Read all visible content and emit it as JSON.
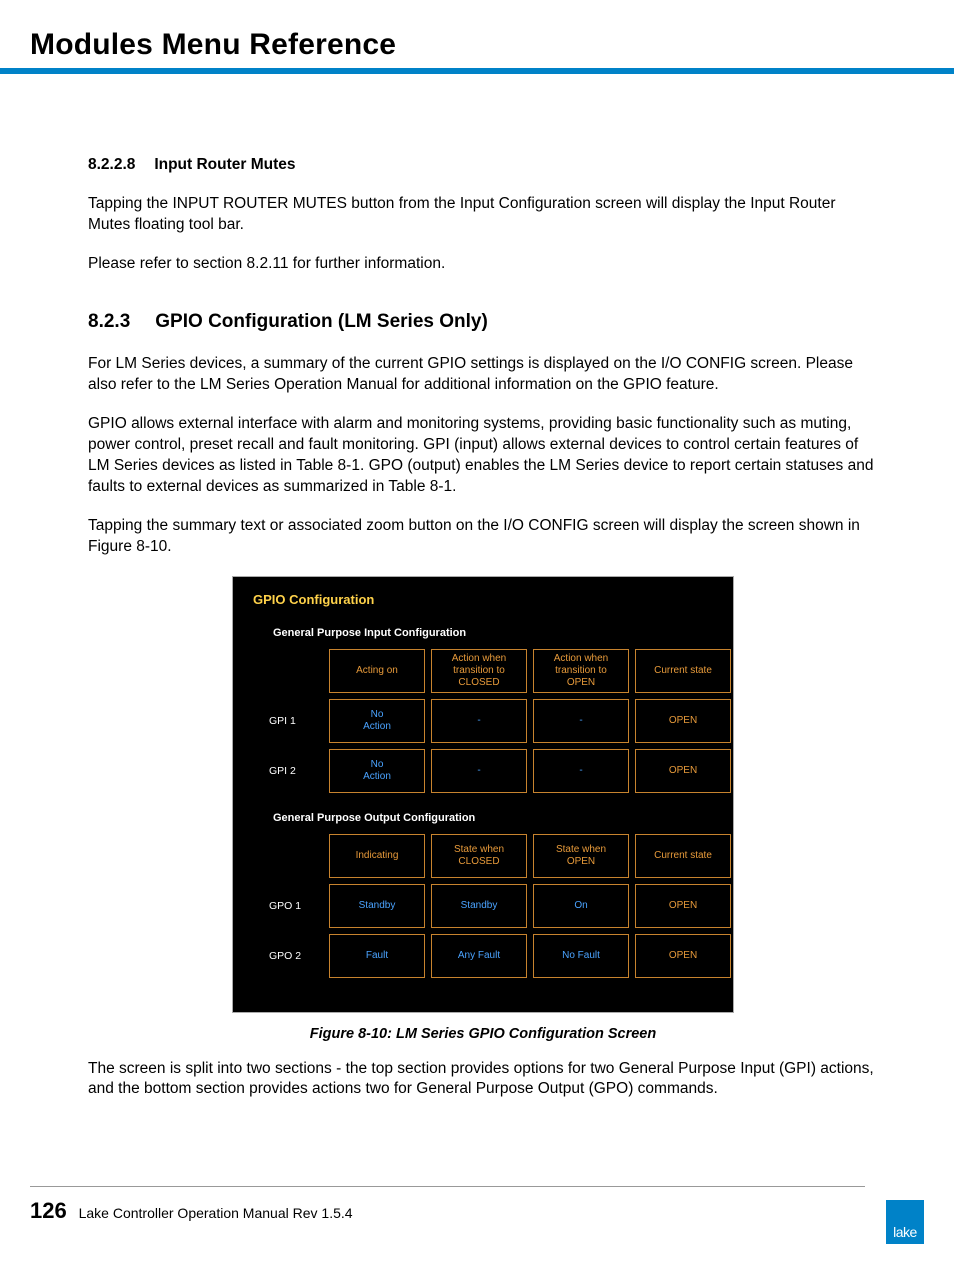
{
  "header": {
    "title": "Modules Menu Reference"
  },
  "section_8228": {
    "num": "8.2.2.8",
    "title": "Input Router Mutes",
    "p1": "Tapping the INPUT ROUTER MUTES button from the Input Configuration screen will display the Input Router Mutes floating tool bar.",
    "p2": "Please refer to section 8.2.11 for further information."
  },
  "section_823": {
    "num": "8.2.3",
    "title": "GPIO Configuration (LM Series Only)",
    "p1": "For LM Series devices, a summary of the current GPIO settings is displayed on the I/O CONFIG screen. Please also refer to the LM Series Operation Manual for additional information on the GPIO feature.",
    "p2": "GPIO allows external interface with alarm and monitoring systems, providing basic functionality such as muting, power control, preset recall and fault monitoring. GPI (input) allows external devices to control certain features of LM Series devices as listed in Table 8-1. GPO (output) enables the LM Series device to report certain statuses and faults to external devices as summarized in Table 8-1.",
    "p3": "Tapping the summary text or associated zoom button on the I/O CONFIG screen will display the screen shown in Figure 8-10.",
    "p4": "The screen is split into two sections - the top section provides options for two General Purpose Input (GPI) actions, and the bottom section provides actions two for General Purpose Output (GPO) commands."
  },
  "figure": {
    "panel_title": "GPIO Configuration",
    "input_section": "General Purpose Input Configuration",
    "output_section": "General Purpose Output Configuration",
    "in_headers": [
      "Acting on",
      "Action when\ntransition to\nCLOSED",
      "Action when\ntransition to\nOPEN",
      "Current state"
    ],
    "in_rows": [
      {
        "label": "GPI 1",
        "c1": "No\nAction",
        "c2": "-",
        "c3": "-",
        "c4": "OPEN"
      },
      {
        "label": "GPI 2",
        "c1": "No\nAction",
        "c2": "-",
        "c3": "-",
        "c4": "OPEN"
      }
    ],
    "out_headers": [
      "Indicating",
      "State when\nCLOSED",
      "State when\nOPEN",
      "Current state"
    ],
    "out_rows": [
      {
        "label": "GPO 1",
        "c1": "Standby",
        "c2": "Standby",
        "c3": "On",
        "c4": "OPEN"
      },
      {
        "label": "GPO 2",
        "c1": "Fault",
        "c2": "Any Fault",
        "c3": "No Fault",
        "c4": "OPEN"
      }
    ],
    "caption": "Figure 8-10: LM Series GPIO Configuration Screen"
  },
  "footer": {
    "page": "126",
    "text": "Lake Controller Operation Manual Rev 1.5.4",
    "logo": "lake"
  }
}
